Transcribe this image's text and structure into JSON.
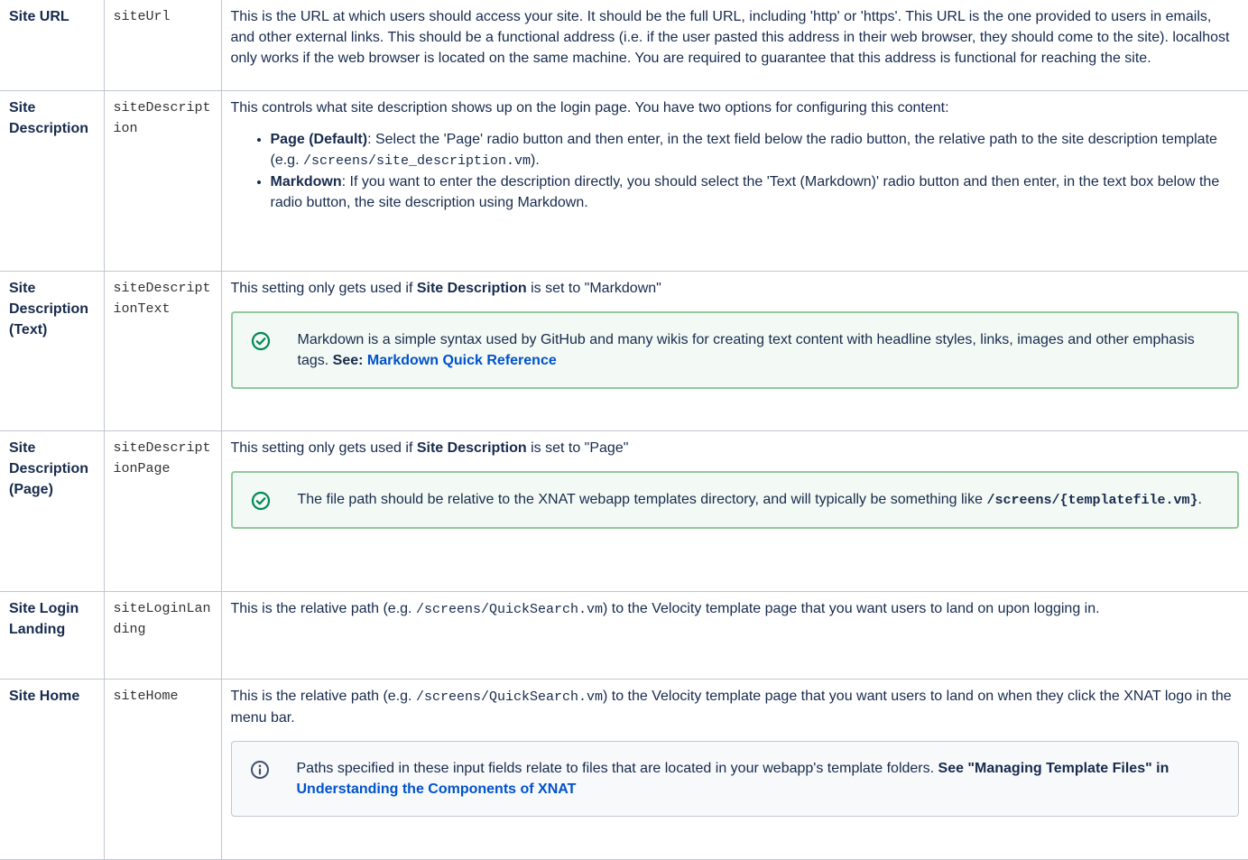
{
  "rows": [
    {
      "name": "Site URL",
      "key": "siteUrl",
      "desc": "This is the URL at which users should access your site. It should be the full URL, including 'http' or 'https'. This URL is the one provided to users in emails, and other external links. This should be a functional address (i.e. if the user pasted this address in their web browser, they should come to the site). localhost only works if the web browser is located on the same machine. You are required to guarantee that this address is functional for reaching the site."
    },
    {
      "name": "Site Description",
      "key": "siteDescription",
      "intro": "This controls what site description shows up on the login page. You have two options for configuring this content:",
      "bullet1_bold": "Page (Default)",
      "bullet1_text": ": Select the 'Page' radio button and then enter, in the text field below the radio button, the relative path to the site description template (e.g. ",
      "bullet1_code": "/screens/site_description.vm",
      "bullet1_end": ").",
      "bullet2_bold": "Markdown",
      "bullet2_text": ": If you want to enter the description directly, you should select the 'Text (Markdown)' radio button and then enter, in the text box below the radio button, the site description using Markdown."
    },
    {
      "name": "Site Description (Text)",
      "key": "siteDescriptionText",
      "pre": "This setting only gets used if ",
      "bold": "Site Description",
      "post": " is set to \"Markdown\"",
      "panel_text": "Markdown is a simple syntax used by GitHub and many wikis for creating text content with headline styles, links, images and other emphasis tags. ",
      "panel_see": "See: ",
      "panel_link": "Markdown Quick Reference"
    },
    {
      "name": "Site Description (Page)",
      "key": "siteDescriptionPage",
      "pre": "This setting only gets used if ",
      "bold": "Site Description",
      "post": " is set to \"Page\"",
      "panel_text": "The file path should be relative to the XNAT webapp templates directory, and will typically be something like ",
      "panel_code": "/screens/{templatefile.vm}",
      "panel_end": "."
    },
    {
      "name": "Site Login Landing",
      "key": "siteLoginLanding",
      "pre": "This is the relative path (e.g. ",
      "code": "/screens/QuickSearch.vm",
      "post": ") to the Velocity template page that you want users to land on upon logging in."
    },
    {
      "name": "Site Home",
      "key": "siteHome",
      "pre": "This is the relative path (e.g. ",
      "code": "/screens/QuickSearch.vm",
      "post": ") to the Velocity template page that you want users to land on when they click the XNAT logo in the menu bar.",
      "panel_text": "Paths specified in these input fields relate to files that are located in your webapp's template folders. ",
      "panel_bold": "See \"Managing Template Files\" in ",
      "panel_link": "Understanding the Components of XNAT"
    }
  ],
  "icons": {
    "tip": "check-circle-icon",
    "info": "info-circle-icon",
    "tip_color": "#00875a",
    "info_color": "#42526e"
  }
}
